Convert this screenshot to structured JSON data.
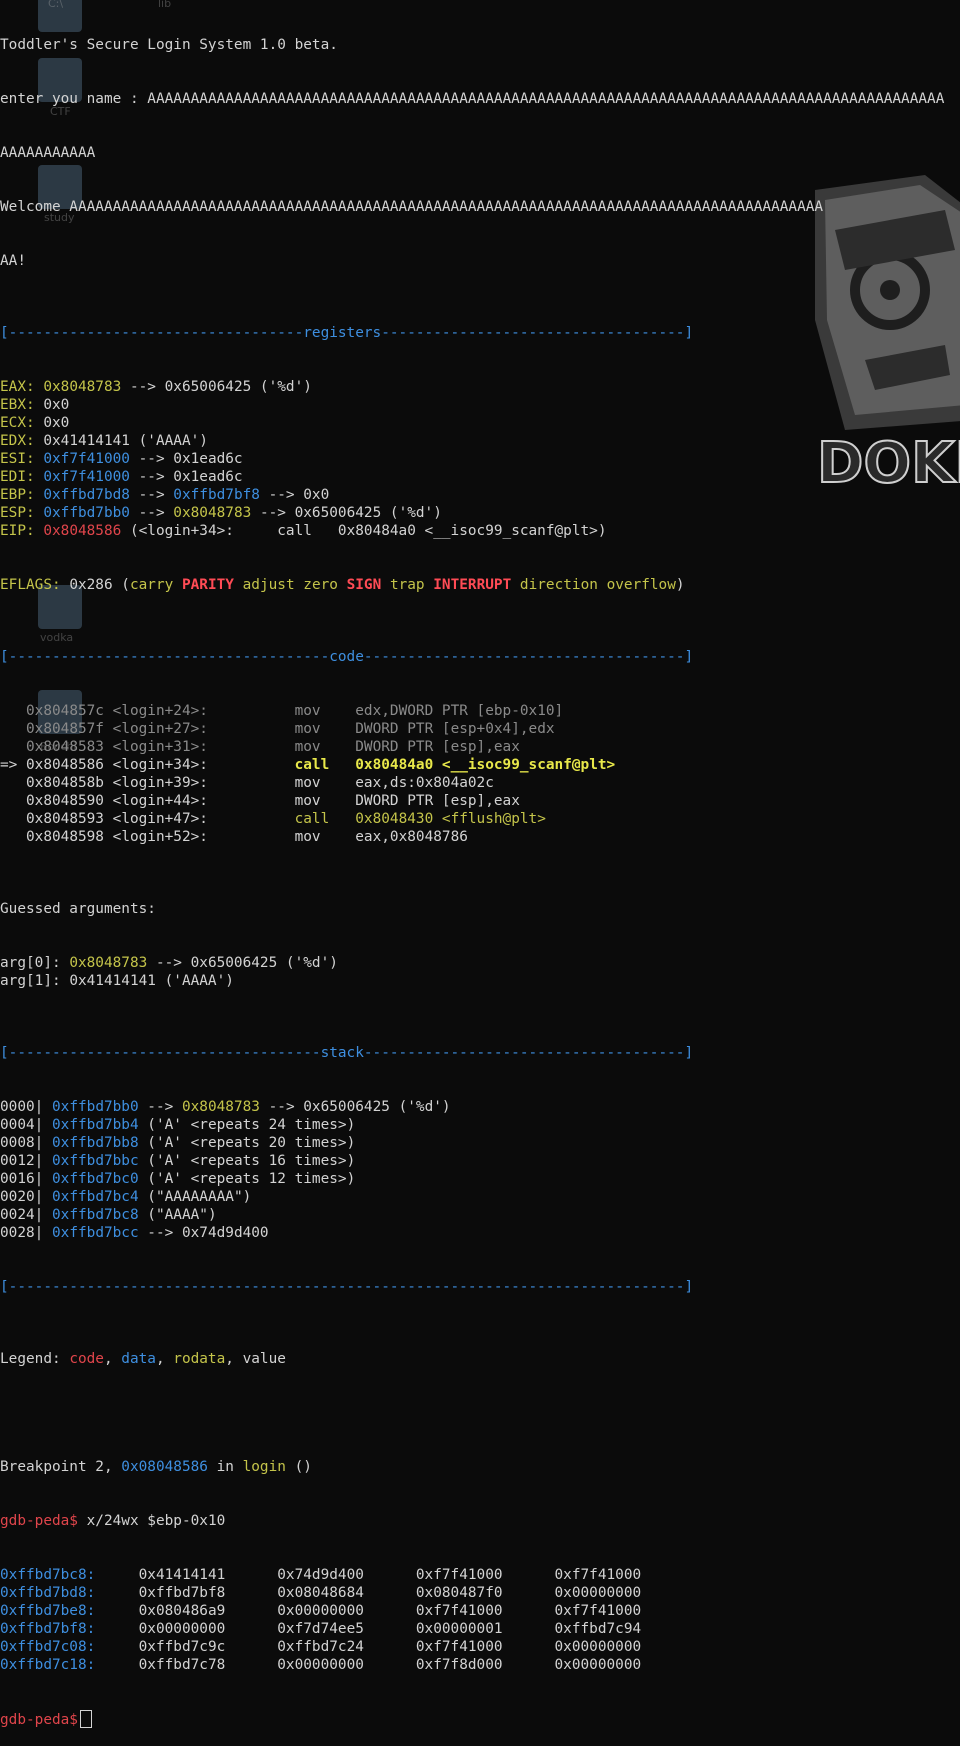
{
  "wallpaper": {
    "icon_labels": [
      "C:\\",
      "lib",
      "CTF",
      "study",
      "vodka",
      "Bocchi"
    ],
    "watermark_text": "DOKK",
    "logo": "anime-face-logo"
  },
  "banner": {
    "title": "Toddler's Secure Login System 1.0 beta.",
    "prompt": "enter you name : ",
    "name_line1": "AAAAAAAAAAAAAAAAAAAAAAAAAAAAAAAAAAAAAAAAAAAAAAAAAAAAAAAAAAAAAAAAAAAAAAAAAAAAAAAAAAAAAAAAAAAA",
    "name_line2": "AAAAAAAAAAA",
    "welcome_line1": "Welcome AAAAAAAAAAAAAAAAAAAAAAAAAAAAAAAAAAAAAAAAAAAAAAAAAAAAAAAAAAAAAAAAAAAAAAAAAAAAAAAAAAAAAAA",
    "welcome_line2": "AA!"
  },
  "sections": {
    "registers": "[----------------------------------registers-----------------------------------]",
    "code": "[-------------------------------------code-------------------------------------]",
    "stack": "[------------------------------------stack-------------------------------------]",
    "end": "[------------------------------------------------------------------------------]"
  },
  "registers": [
    {
      "name": "EAX:",
      "value": "0x8048783",
      "rest": " --> 0x65006425 ('%d')"
    },
    {
      "name": "EBX:",
      "value": "",
      "rest": "0x0"
    },
    {
      "name": "ECX:",
      "value": "",
      "rest": "0x0"
    },
    {
      "name": "EDX:",
      "value": "",
      "rest": "0x41414141 ('AAAA')"
    },
    {
      "name": "ESI:",
      "value": "0xf7f41000",
      "rest": " --> 0x1ead6c"
    },
    {
      "name": "EDI:",
      "value": "0xf7f41000",
      "rest": " --> 0x1ead6c"
    },
    {
      "name": "EBP:",
      "value": "0xffbd7bd8",
      "rest": " --> ",
      "value2": "0xffbd7bf8",
      "rest2": " --> 0x0"
    },
    {
      "name": "ESP:",
      "value": "0xffbd7bb0",
      "rest": " --> ",
      "value2": "0x8048783",
      "rest2": " --> 0x65006425 ('%d')"
    },
    {
      "name": "EIP:",
      "value": "0x8048586",
      "rest": " (<login+34>:     call   0x80484a0 <__isoc99_scanf@plt>)"
    }
  ],
  "eflags": {
    "label": "EFLAGS:",
    "value": " 0x286 (",
    "flags": [
      {
        "text": "carry",
        "set": false
      },
      {
        "text": "PARITY",
        "set": true
      },
      {
        "text": "adjust",
        "set": false
      },
      {
        "text": "zero",
        "set": false
      },
      {
        "text": "SIGN",
        "set": true
      },
      {
        "text": "trap",
        "set": false
      },
      {
        "text": "INTERRUPT",
        "set": true
      },
      {
        "text": "direction",
        "set": false
      },
      {
        "text": "overflow",
        "set": false
      }
    ],
    "close": ")"
  },
  "code": [
    {
      "marker": "   ",
      "addr": "0x804857c",
      "sym": "<login+24>:",
      "mnem": "mov",
      "ops": "edx,DWORD PTR [ebp-0x10]",
      "state": "past"
    },
    {
      "marker": "   ",
      "addr": "0x804857f",
      "sym": "<login+27>:",
      "mnem": "mov",
      "ops": "DWORD PTR [esp+0x4],edx",
      "state": "past"
    },
    {
      "marker": "   ",
      "addr": "0x8048583",
      "sym": "<login+31>:",
      "mnem": "mov",
      "ops": "DWORD PTR [esp],eax",
      "state": "past"
    },
    {
      "marker": "=> ",
      "addr": "0x8048586",
      "sym": "<login+34>:",
      "mnem": "call",
      "ops": "0x80484a0 <__isoc99_scanf@plt>",
      "state": "current"
    },
    {
      "marker": "   ",
      "addr": "0x804858b",
      "sym": "<login+39>:",
      "mnem": "mov",
      "ops": "eax,ds:0x804a02c",
      "state": "next"
    },
    {
      "marker": "   ",
      "addr": "0x8048590",
      "sym": "<login+44>:",
      "mnem": "mov",
      "ops": "DWORD PTR [esp],eax",
      "state": "next"
    },
    {
      "marker": "   ",
      "addr": "0x8048593",
      "sym": "<login+47>:",
      "mnem": "call",
      "ops": "0x8048430 <fflush@plt>",
      "state": "next-call"
    },
    {
      "marker": "   ",
      "addr": "0x8048598",
      "sym": "<login+52>:",
      "mnem": "mov",
      "ops": "eax,0x8048786",
      "state": "next"
    }
  ],
  "guessed": {
    "title": "Guessed arguments:",
    "args": [
      {
        "label": "arg[0]: ",
        "value": "0x8048783",
        "rest": " --> 0x65006425 ('%d')"
      },
      {
        "label": "arg[1]: ",
        "value": "",
        "rest": "0x41414141 ('AAAA')"
      }
    ]
  },
  "stack": [
    {
      "off": "0000|",
      "addr": "0xffbd7bb0",
      "mid": " --> ",
      "ptr": "0x8048783",
      "rest": " --> 0x65006425 ('%d')"
    },
    {
      "off": "0004|",
      "addr": "0xffbd7bb4",
      "mid": " ('A' <repeats 24 times>)",
      "ptr": "",
      "rest": ""
    },
    {
      "off": "0008|",
      "addr": "0xffbd7bb8",
      "mid": " ('A' <repeats 20 times>)",
      "ptr": "",
      "rest": ""
    },
    {
      "off": "0012|",
      "addr": "0xffbd7bbc",
      "mid": " ('A' <repeats 16 times>)",
      "ptr": "",
      "rest": ""
    },
    {
      "off": "0016|",
      "addr": "0xffbd7bc0",
      "mid": " ('A' <repeats 12 times>)",
      "ptr": "",
      "rest": ""
    },
    {
      "off": "0020|",
      "addr": "0xffbd7bc4",
      "mid": " (\"AAAAAAAA\")",
      "ptr": "",
      "rest": ""
    },
    {
      "off": "0024|",
      "addr": "0xffbd7bc8",
      "mid": " (\"AAAA\")",
      "ptr": "",
      "rest": ""
    },
    {
      "off": "0028|",
      "addr": "0xffbd7bcc",
      "mid": " --> 0x74d9d400",
      "ptr": "",
      "rest": ""
    }
  ],
  "legend": {
    "label": "Legend: ",
    "code": "code",
    "data": "data",
    "rodata": "rodata",
    "value": "value",
    "sep": ", "
  },
  "breakpoint": {
    "prefix": "Breakpoint 2, ",
    "addr": "0x08048586",
    "mid": " in ",
    "func": "login",
    "suffix": " ()"
  },
  "command": {
    "prompt": "gdb-peda$",
    "text": " x/24wx $ebp-0x10"
  },
  "memory": [
    {
      "addr": "0xffbd7bc8:",
      "words": [
        "0x41414141",
        "0x74d9d400",
        "0xf7f41000",
        "0xf7f41000"
      ]
    },
    {
      "addr": "0xffbd7bd8:",
      "words": [
        "0xffbd7bf8",
        "0x08048684",
        "0x080487f0",
        "0x00000000"
      ]
    },
    {
      "addr": "0xffbd7be8:",
      "words": [
        "0x080486a9",
        "0x00000000",
        "0xf7f41000",
        "0xf7f41000"
      ]
    },
    {
      "addr": "0xffbd7bf8:",
      "words": [
        "0x00000000",
        "0xf7d74ee5",
        "0x00000001",
        "0xffbd7c94"
      ]
    },
    {
      "addr": "0xffbd7c08:",
      "words": [
        "0xffbd7c9c",
        "0xffbd7c24",
        "0xf7f41000",
        "0x00000000"
      ]
    },
    {
      "addr": "0xffbd7c18:",
      "words": [
        "0xffbd7c78",
        "0x00000000",
        "0xf7f8d000",
        "0x00000000"
      ]
    }
  ],
  "final_prompt": "gdb-peda$",
  "colors": {
    "background": "#0b0b0b",
    "text": "#d3d3d3",
    "yellow": "#c4c44a",
    "blue": "#3e8fe0",
    "red": "#e0454b",
    "gray": "#8a8a8a"
  }
}
